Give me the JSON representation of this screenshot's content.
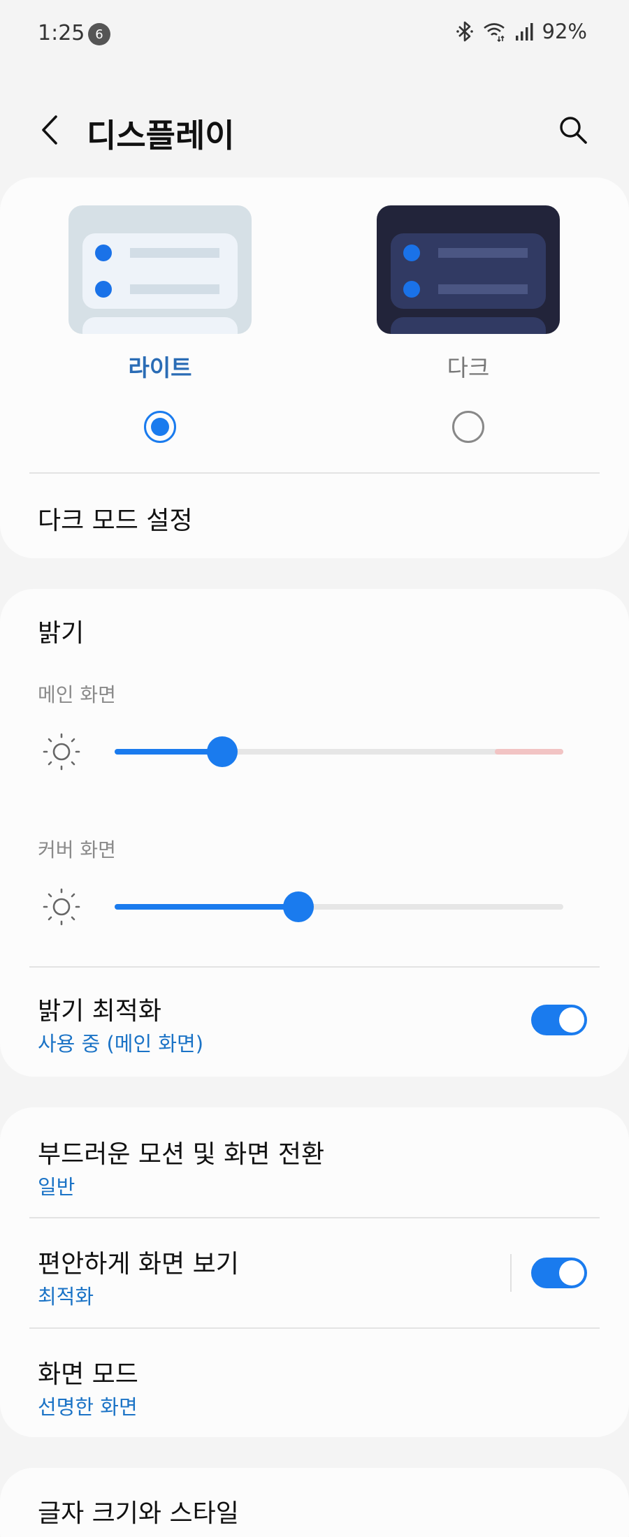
{
  "status_bar": {
    "time": "1:25",
    "notification_count": "6",
    "battery": "92%",
    "icons": [
      "bluetooth-icon",
      "wifi-icon",
      "signal-icon"
    ]
  },
  "header": {
    "title": "디스플레이",
    "back_icon": "back-arrow-icon",
    "search_icon": "search-icon"
  },
  "theme": {
    "light_label": "라이트",
    "dark_label": "다크",
    "selected": "light",
    "dark_mode_settings": "다크 모드 설정"
  },
  "brightness": {
    "title": "밝기",
    "main_screen_label": "메인 화면",
    "main_level": 0.24,
    "cover_screen_label": "커버 화면",
    "cover_level": 0.41,
    "adaptive_title": "밝기 최적화",
    "adaptive_sub": "사용 중 (메인 화면)",
    "adaptive_on": true
  },
  "settings": {
    "motion_title": "부드러운 모션 및 화면 전환",
    "motion_sub": "일반",
    "eye_comfort_title": "편안하게 화면 보기",
    "eye_comfort_sub": "최적화",
    "eye_comfort_on": true,
    "screen_mode_title": "화면 모드",
    "screen_mode_sub": "선명한 화면",
    "font_title": "글자 크기와 스타일"
  },
  "colors": {
    "accent": "#1a7bee",
    "link": "#1b73c6",
    "background": "#f4f4f4",
    "card": "#fcfcfc"
  }
}
